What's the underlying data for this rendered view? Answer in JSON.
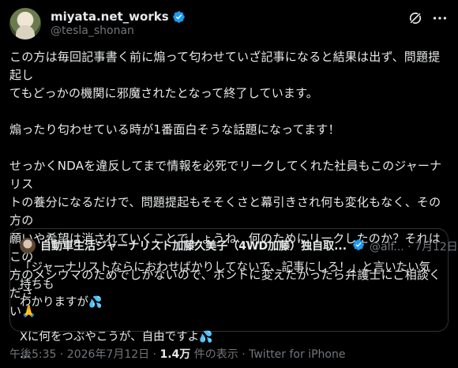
{
  "author": {
    "display_name": "miyata.net_works",
    "handle": "@tesla_shonan"
  },
  "tweet": {
    "text": "この方は毎回記事書く前に煽って匂わせていざ記事になると結果は出ず、問題提起し\nてもどっかの機関に邪魔されたとなって終了しています。\n\n煽ったり匂わせている時が1番面白そうな話題になってます！\n\nせっかくNDAを違反してまで情報を必死でリークしてくれた社員もこのジャーナリス\nトの養分になるだけで、問題提起もそそくさと幕引きされ何も変化もなく、その方の\n願いや希望は消されていくことでしょうね...何のためにリークしたのか？それはこの\n方のメシウマのためでしかないので、ホントに変えたかったら弁護士にご相談くださ\nい🙏"
  },
  "quote": {
    "name": "自動車生活ジャーナリスト加藤久美子（4WD加藤）独自取...",
    "handle_date": "@alf... · 7月12日",
    "line1": "「ジャーナリストならにおわせばかりしてないで、記事にしろ！」と言いたい気持ちも",
    "line2": "わかりますが",
    "line3": "Xに何をつぶやこうが、自由ですよ",
    "line4": "..."
  },
  "meta": {
    "time_date": "午後5:35 · 2026年7月12日 · ",
    "views": "1.4万",
    "views_label": " 件の表示 · ",
    "source": "Twitter for iPhone"
  },
  "colors": {
    "background": "#000000",
    "verified": "#1d9bf0",
    "secondary_text": "#71767b"
  }
}
